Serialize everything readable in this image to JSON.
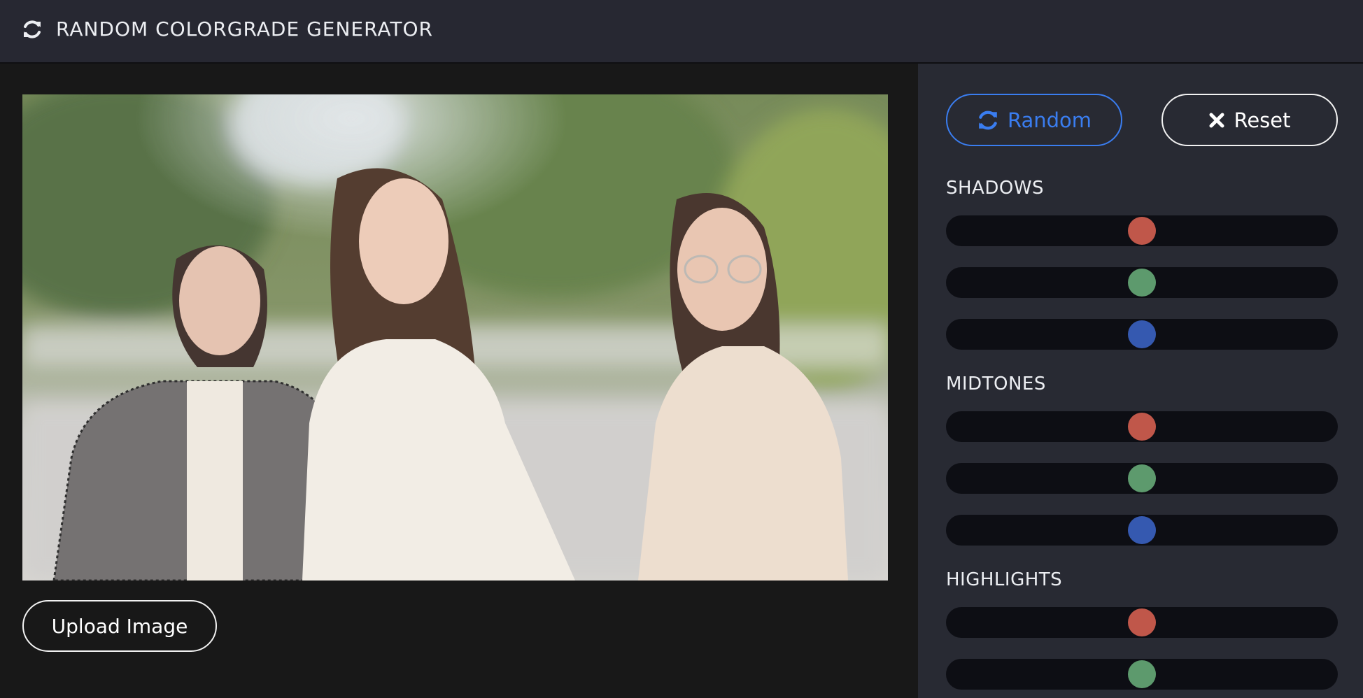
{
  "app": {
    "title": "RANDOM COLORGRADE GENERATOR",
    "icon": "refresh-icon"
  },
  "main": {
    "upload_label": "Upload Image"
  },
  "controls": {
    "random_label": "Random",
    "reset_label": "Reset",
    "random_icon": "refresh-icon",
    "reset_icon": "close-icon",
    "accent_color": "#3a7df0"
  },
  "groups": [
    {
      "label": "SHADOWS",
      "sliders": [
        {
          "channel": "red",
          "color": "#c0574a",
          "value": 0.5
        },
        {
          "channel": "green",
          "color": "#5d9a6d",
          "value": 0.5
        },
        {
          "channel": "blue",
          "color": "#3559b0",
          "value": 0.5
        }
      ]
    },
    {
      "label": "MIDTONES",
      "sliders": [
        {
          "channel": "red",
          "color": "#c0574a",
          "value": 0.5
        },
        {
          "channel": "green",
          "color": "#5d9a6d",
          "value": 0.5
        },
        {
          "channel": "blue",
          "color": "#3559b0",
          "value": 0.5
        }
      ]
    },
    {
      "label": "HIGHLIGHTS",
      "sliders": [
        {
          "channel": "red",
          "color": "#c0574a",
          "value": 0.5
        },
        {
          "channel": "green",
          "color": "#5d9a6d",
          "value": 0.5
        }
      ]
    }
  ]
}
